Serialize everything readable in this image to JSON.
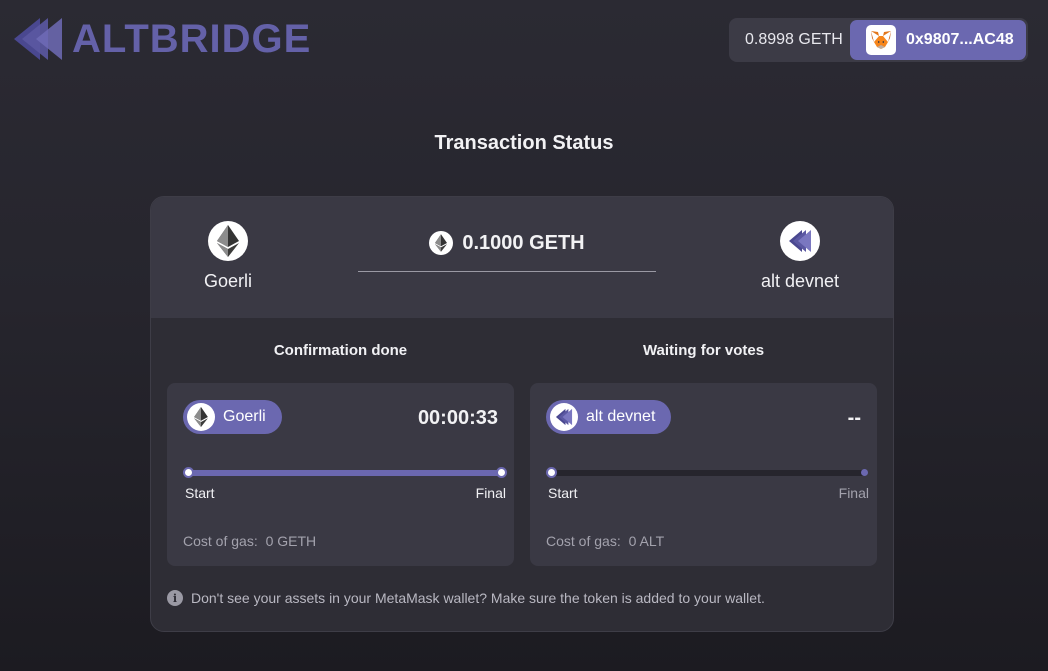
{
  "header": {
    "logo_text": "ALTBRIDGE",
    "balance": "0.8998 GETH",
    "account": "0x9807...AC48"
  },
  "page": {
    "title": "Transaction Status"
  },
  "transfer": {
    "from_chain": "Goerli",
    "to_chain": "alt devnet",
    "amount": "0.1000 GETH",
    "icons": {
      "from": "ethereum-icon",
      "to": "altlayer-icon",
      "amount": "ethereum-icon"
    }
  },
  "stages": [
    {
      "title": "Confirmation done",
      "chain": "Goerli",
      "timer": "00:00:33",
      "progress": 1.0,
      "start_label": "Start",
      "final_label": "Final",
      "gas_label": "Cost of gas:",
      "gas_value": "0 GETH"
    },
    {
      "title": "Waiting for votes",
      "chain": "alt devnet",
      "timer": "--",
      "progress": 0.0,
      "start_label": "Start",
      "final_label": "Final",
      "gas_label": "Cost of gas:",
      "gas_value": "0 ALT"
    }
  ],
  "note": "Don't see your assets in your MetaMask wallet? Make sure the token is added to your wallet.",
  "colors": {
    "accent": "#6b68b0",
    "logo": "#6461a8",
    "background": "#26252d",
    "panel": "#3a3944"
  }
}
